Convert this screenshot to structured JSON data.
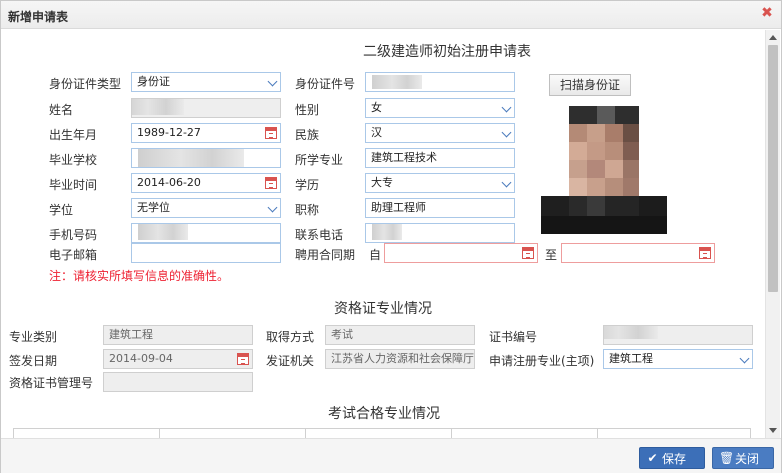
{
  "dialog": {
    "title": "新增申请表",
    "close_icon": "close-icon"
  },
  "form": {
    "title": "二级建造师初始注册申请表",
    "id_type": {
      "label": "身份证件类型",
      "value": "身份证"
    },
    "id_number": {
      "label": "身份证件号",
      "value": ""
    },
    "scan_button": "扫描身份证",
    "name": {
      "label": "姓名",
      "value": ""
    },
    "gender": {
      "label": "性别",
      "value": "女"
    },
    "birth": {
      "label": "出生年月",
      "value": "1989-12-27"
    },
    "ethnicity": {
      "label": "民族",
      "value": "汉"
    },
    "school": {
      "label": "毕业学校",
      "value": ""
    },
    "major": {
      "label": "所学专业",
      "value": "建筑工程技术"
    },
    "grad_date": {
      "label": "毕业时间",
      "value": "2014-06-20"
    },
    "education": {
      "label": "学历",
      "value": "大专"
    },
    "degree": {
      "label": "学位",
      "value": "无学位"
    },
    "title_job": {
      "label": "职称",
      "value": "助理工程师"
    },
    "phone": {
      "label": "手机号码",
      "value": ""
    },
    "contact": {
      "label": "联系电话",
      "value": ""
    },
    "email": {
      "label": "电子邮箱",
      "value": ""
    },
    "contract": {
      "label": "聘用合同期",
      "from": "自",
      "to": "至",
      "from_value": "",
      "to_value": ""
    },
    "note": "注：请核实所填写信息的准确性。"
  },
  "cert": {
    "title": "资格证专业情况",
    "category": {
      "label": "专业类别",
      "value": "建筑工程"
    },
    "method": {
      "label": "取得方式",
      "value": "考试"
    },
    "cert_no": {
      "label": "证书编号",
      "value": ""
    },
    "issue_date": {
      "label": "签发日期",
      "value": "2014-09-04"
    },
    "authority": {
      "label": "发证机关",
      "value": "江苏省人力资源和社会保障厅"
    },
    "apply_major": {
      "label": "申请注册专业(主项)",
      "value": "建筑工程"
    },
    "mgmt_no": {
      "label": "资格证书管理号",
      "value": ""
    }
  },
  "exam": {
    "title": "考试合格专业情况"
  },
  "footer": {
    "save": "保存",
    "close": "关闭"
  },
  "colors": {
    "accent": "#3c6fb8",
    "input_border": "#aac8e8",
    "warning": "#e22233"
  }
}
